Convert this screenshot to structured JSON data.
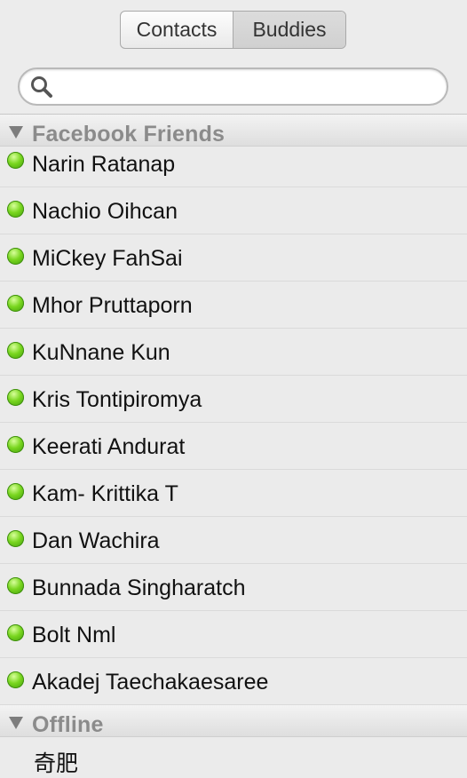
{
  "segmented": {
    "contacts": "Contacts",
    "buddies": "Buddies"
  },
  "search": {
    "value": "",
    "placeholder": ""
  },
  "groups": [
    {
      "title": "Facebook Friends",
      "status": "online",
      "status_color": "#5cc217",
      "members": [
        "Narin Ratanap",
        "Nachio Oihcan",
        "MiCkey FahSai",
        "Mhor Pruttaporn",
        "KuNnane Kun",
        "Kris Tontipiromya",
        "Keerati Andurat",
        "Kam- Krittika T",
        "Dan Wachira",
        "Bunnada Singharatch",
        "Bolt Nml",
        "Akadej Taechakaesaree"
      ]
    },
    {
      "title": "Offline",
      "status": "offline",
      "members": [
        "奇肥"
      ]
    }
  ],
  "icons": {
    "search": "search-icon",
    "status": "online-status-icon",
    "collapse": "disclosure-triangle-icon"
  }
}
